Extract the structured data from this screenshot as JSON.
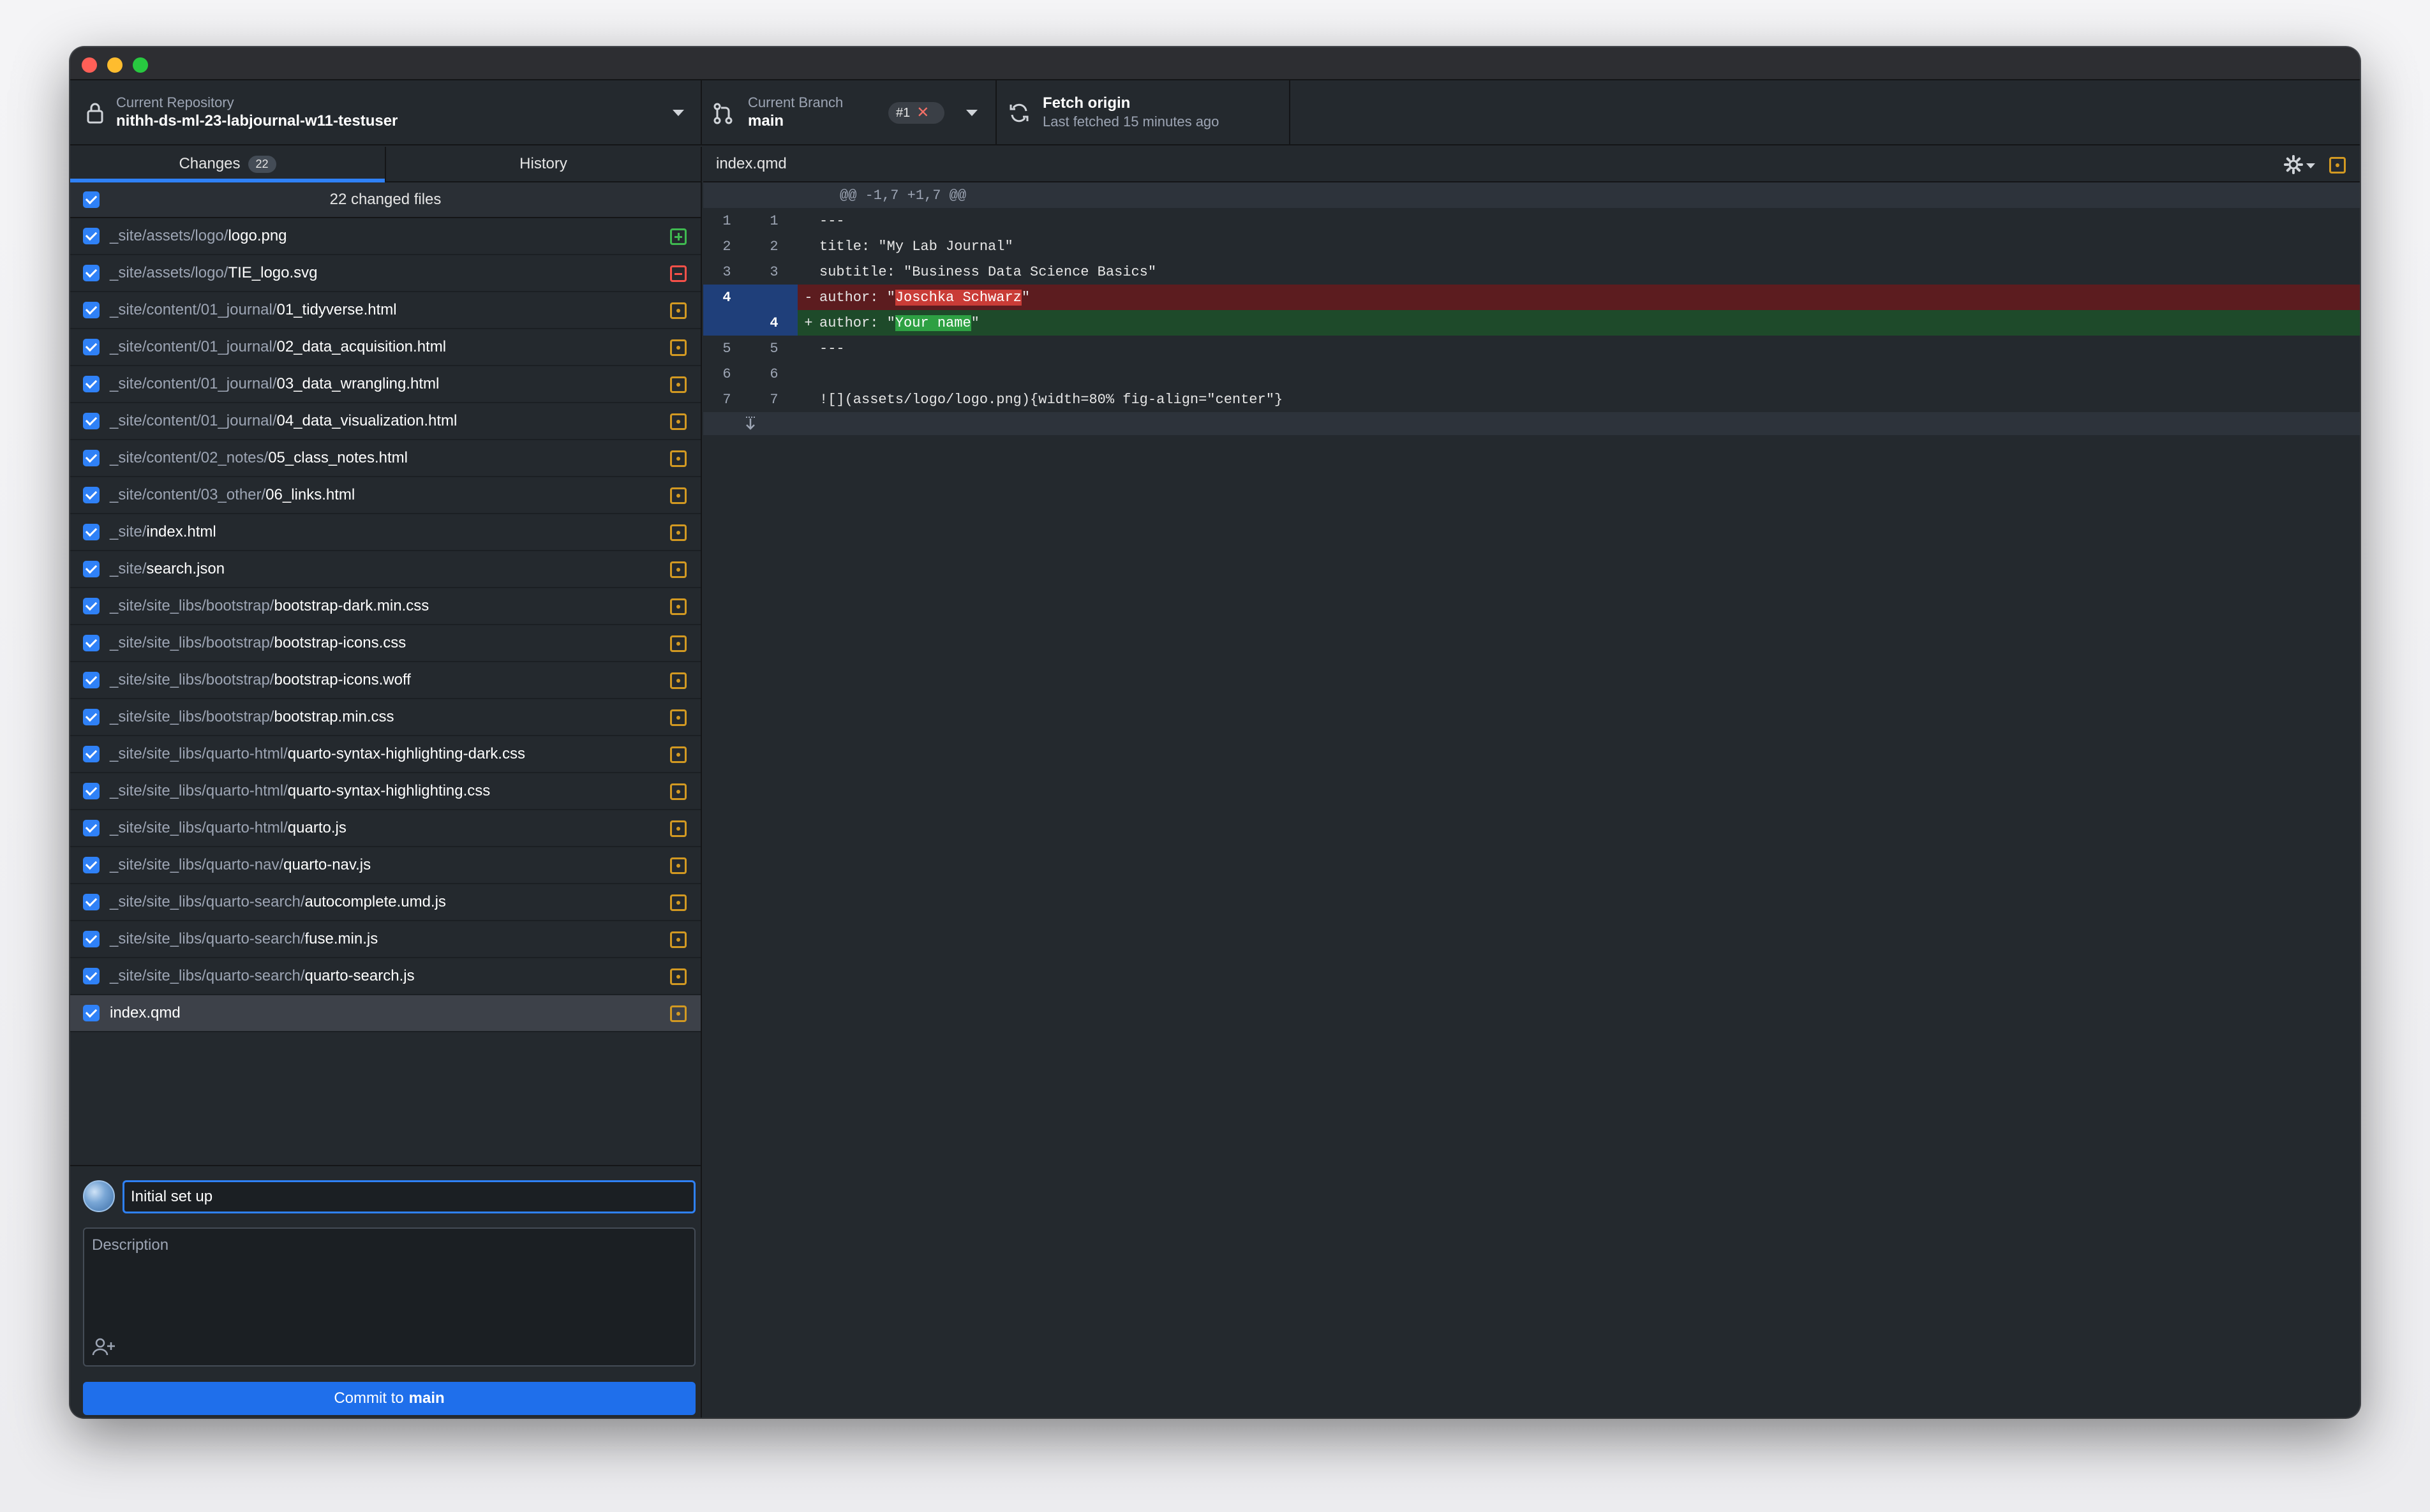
{
  "toolbar": {
    "repo_label": "Current Repository",
    "repo_name": "nithh-ds-ml-23-labjournal-w11-testuser",
    "branch_label": "Current Branch",
    "branch_name": "main",
    "pr_badge": "#1",
    "fetch_title": "Fetch origin",
    "fetch_sub": "Last fetched 15 minutes ago"
  },
  "tabs": {
    "changes": "Changes",
    "changes_count": "22",
    "history": "History"
  },
  "changed_files_label": "22 changed files",
  "files": [
    {
      "dir": "_site/assets/logo/",
      "name": "logo.png",
      "status": "add"
    },
    {
      "dir": "_site/assets/logo/",
      "name": "TIE_logo.svg",
      "status": "del"
    },
    {
      "dir": "_site/content/01_journal/",
      "name": "01_tidyverse.html",
      "status": "mod"
    },
    {
      "dir": "_site/content/01_journal/",
      "name": "02_data_acquisition.html",
      "status": "mod"
    },
    {
      "dir": "_site/content/01_journal/",
      "name": "03_data_wrangling.html",
      "status": "mod"
    },
    {
      "dir": "_site/content/01_journal/",
      "name": "04_data_visualization.html",
      "status": "mod"
    },
    {
      "dir": "_site/content/02_notes/",
      "name": "05_class_notes.html",
      "status": "mod"
    },
    {
      "dir": "_site/content/03_other/",
      "name": "06_links.html",
      "status": "mod"
    },
    {
      "dir": "_site/",
      "name": "index.html",
      "status": "mod"
    },
    {
      "dir": "_site/",
      "name": "search.json",
      "status": "mod"
    },
    {
      "dir": "_site/site_libs/bootstrap/",
      "name": "bootstrap-dark.min.css",
      "status": "mod"
    },
    {
      "dir": "_site/site_libs/bootstrap/",
      "name": "bootstrap-icons.css",
      "status": "mod"
    },
    {
      "dir": "_site/site_libs/bootstrap/",
      "name": "bootstrap-icons.woff",
      "status": "mod"
    },
    {
      "dir": "_site/site_libs/bootstrap/",
      "name": "bootstrap.min.css",
      "status": "mod"
    },
    {
      "dir": "_site/site_libs/quarto-html/",
      "name": "quarto-syntax-highlighting-dark.css",
      "status": "mod"
    },
    {
      "dir": "_site/site_libs/quarto-html/",
      "name": "quarto-syntax-highlighting.css",
      "status": "mod"
    },
    {
      "dir": "_site/site_libs/quarto-html/",
      "name": "quarto.js",
      "status": "mod"
    },
    {
      "dir": "_site/site_libs/quarto-nav/",
      "name": "quarto-nav.js",
      "status": "mod"
    },
    {
      "dir": "_site/site_libs/quarto-search/",
      "name": "autocomplete.umd.js",
      "status": "mod"
    },
    {
      "dir": "_site/site_libs/quarto-search/",
      "name": "fuse.min.js",
      "status": "mod"
    },
    {
      "dir": "_site/site_libs/quarto-search/",
      "name": "quarto-search.js",
      "status": "mod"
    },
    {
      "dir": "",
      "name": "index.qmd",
      "status": "mod",
      "selected": true
    }
  ],
  "commit": {
    "summary_value": "Initial set up",
    "description_placeholder": "Description",
    "button_prefix": "Commit to ",
    "button_branch": "main"
  },
  "diff": {
    "file_name": "index.qmd",
    "hunk_header": "@@ -1,7 +1,7 @@",
    "lines": [
      {
        "type": "ctx",
        "old": "1",
        "new": "1",
        "marker": "",
        "pre": "---",
        "hl": "",
        "post": ""
      },
      {
        "type": "ctx",
        "old": "2",
        "new": "2",
        "marker": "",
        "pre": "title: \"My Lab Journal\"",
        "hl": "",
        "post": ""
      },
      {
        "type": "ctx",
        "old": "3",
        "new": "3",
        "marker": "",
        "pre": "subtitle: \"Business Data Science Basics\"",
        "hl": "",
        "post": ""
      },
      {
        "type": "del",
        "old": "4",
        "new": "",
        "marker": "-",
        "pre": "author: \"",
        "hl": "Joschka Schwarz",
        "post": "\""
      },
      {
        "type": "add",
        "old": "",
        "new": "4",
        "marker": "+",
        "pre": "author: \"",
        "hl": "Your name",
        "post": "\""
      },
      {
        "type": "ctx",
        "old": "5",
        "new": "5",
        "marker": "",
        "pre": "---",
        "hl": "",
        "post": ""
      },
      {
        "type": "ctx",
        "old": "6",
        "new": "6",
        "marker": "",
        "pre": "",
        "hl": "",
        "post": ""
      },
      {
        "type": "ctx",
        "old": "7",
        "new": "7",
        "marker": "",
        "pre": "![](assets/logo/logo.png){width=80% fig-align=\"center\"}",
        "hl": "",
        "post": ""
      }
    ]
  },
  "colors": {
    "accent": "#2f81f7",
    "added": "#3fb950",
    "deleted": "#f85149",
    "modified": "#d29922"
  },
  "icons": [
    "lock-icon",
    "branch-icon",
    "sync-icon",
    "gear-icon",
    "coauthor-icon",
    "expand-icon"
  ]
}
